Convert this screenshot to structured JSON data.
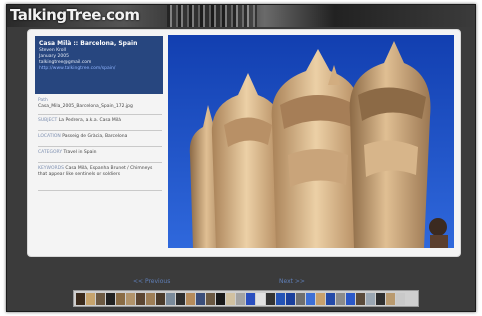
{
  "site": {
    "brand": "TalkingTree.com"
  },
  "photo_info": {
    "title": "Casa Milà :: Barcelona, Spain",
    "author": "Steven Kroll",
    "date": "January 2005",
    "email": "talkingtree@gmail.com",
    "url": "http://www.talkingtree.com/spain/"
  },
  "fields": [
    {
      "key": "Path",
      "value": "Casa_Mila_2005_Barcelona_Spain_172.jpg"
    },
    {
      "key": "SUBJECT",
      "value": "La Pedrera, a.k.a. Casa Milà"
    },
    {
      "key": "LOCATION",
      "value": "Passeig de Gràcia, Barcelona"
    },
    {
      "key": "CATEGORY",
      "value": "Travel in Spain"
    },
    {
      "key": "KEYWORDS",
      "value": "Casa Milà, Espanha Brunet / Chimneys that appear like sentinels or soldiers"
    }
  ],
  "nav": {
    "previous": "<< Previous",
    "next": "Next >>"
  },
  "colors": {
    "info_box": "#27467f",
    "sky": "#1e4fc4",
    "stone": "#c9a47a"
  }
}
